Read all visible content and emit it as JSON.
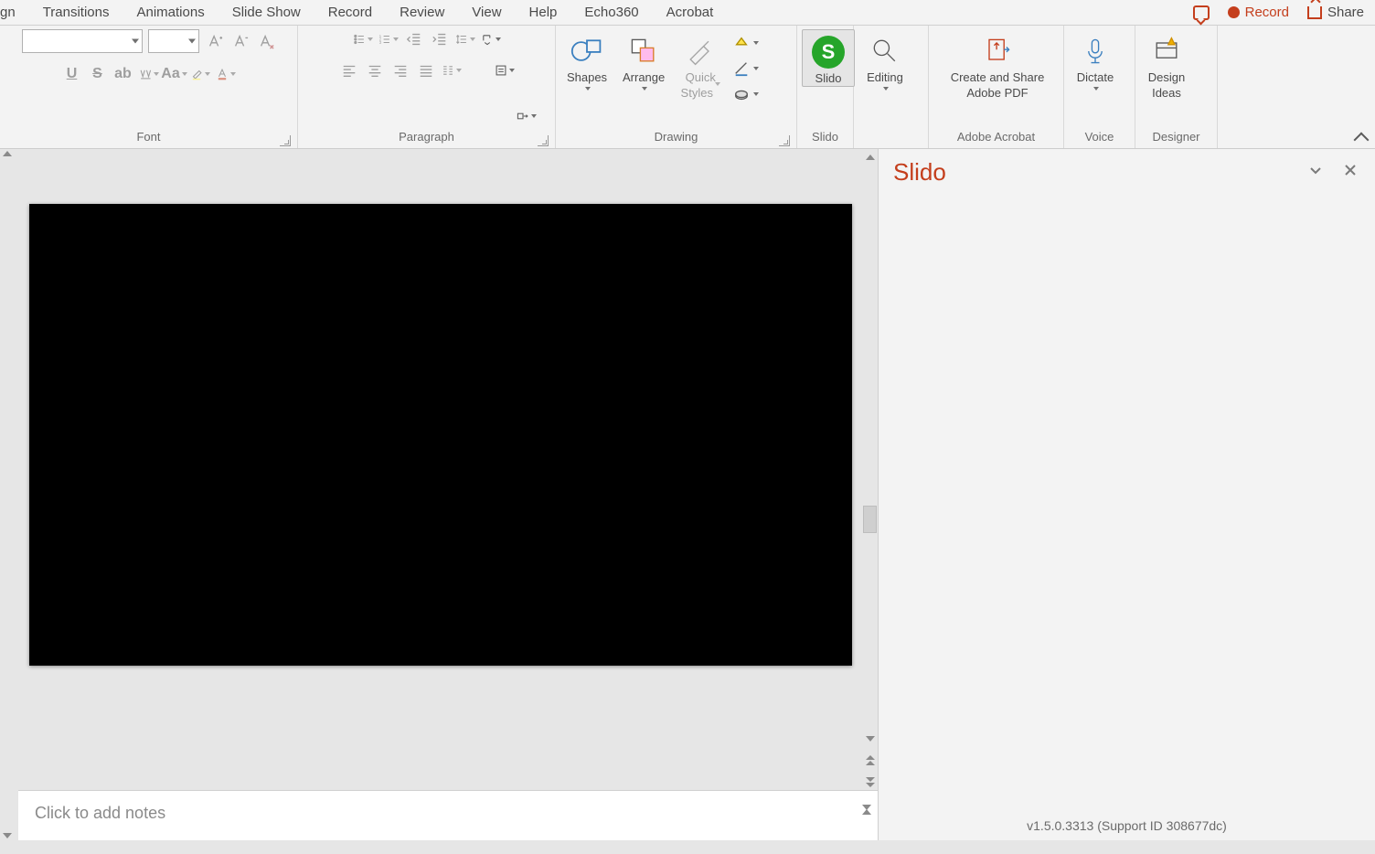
{
  "tabs": {
    "items": [
      "gn",
      "Transitions",
      "Animations",
      "Slide Show",
      "Record",
      "Review",
      "View",
      "Help",
      "Echo360",
      "Acrobat"
    ],
    "record": "Record",
    "share": "Share"
  },
  "ribbon": {
    "font": {
      "label": "Font",
      "family": "",
      "size": ""
    },
    "paragraph": {
      "label": "Paragraph"
    },
    "drawing": {
      "label": "Drawing",
      "shapes": "Shapes",
      "arrange": "Arrange",
      "quick1": "Quick",
      "quick2": "Styles"
    },
    "slido": {
      "label": "Slido",
      "btn": "Slido",
      "glyph": "S"
    },
    "editing": {
      "btn": "Editing"
    },
    "adobe": {
      "label": "Adobe Acrobat",
      "line1": "Create and Share",
      "line2": "Adobe PDF"
    },
    "voice": {
      "label": "Voice",
      "btn": "Dictate"
    },
    "designer": {
      "label": "Designer",
      "line1": "Design",
      "line2": "Ideas"
    }
  },
  "notes": {
    "placeholder": "Click to add notes"
  },
  "panel": {
    "title": "Slido",
    "footer": "v1.5.0.3313 (Support ID 308677dc)"
  }
}
